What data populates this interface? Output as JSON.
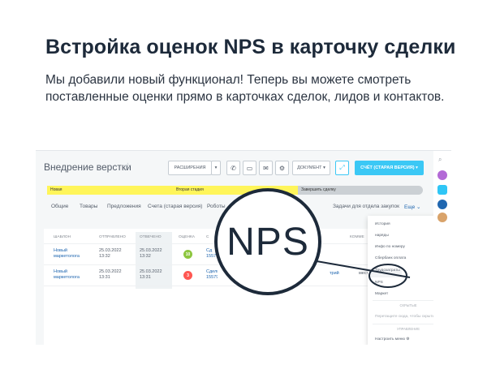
{
  "headline": "Встройка оценок NPS в карточку сделки",
  "subtext": "Мы добавили новый функционал! Теперь вы можете смотреть поставленные оценки прямо в карточках сделок, лидов и контактов.",
  "deal": {
    "title": "Внедрение верстки",
    "star_icon": "star-icon",
    "buttons": {
      "extensions": "РАСШИРЕНИЯ",
      "document": "ДОКУМЕНТ",
      "primary": "СЧЁТ (СТАРАЯ ВЕРСИЯ)"
    },
    "icons": [
      "phone-icon",
      "chat-icon",
      "mail-icon",
      "gear-icon"
    ],
    "stages": [
      "Новая",
      "Вторая стадия",
      "Завершить сделку"
    ]
  },
  "tabs": [
    "Общие",
    "Товары",
    "Предложения",
    "Счета (старая версия)",
    "Роботы",
    "Задачи для отдела закупок",
    "Еще"
  ],
  "table": {
    "headers": [
      "ШАБЛОН",
      "ОТПРАВЛЕНО",
      "ОТВЕЧЕНО",
      "ОЦЕНКА",
      "С",
      "КОММЕ"
    ],
    "rows": [
      {
        "template": "Новый маркетолога",
        "sent": "25.03.2022 13:32",
        "answered": "25.03.2022 13:32",
        "score": "10",
        "deal": "Сд 1557",
        "author": "",
        "comment": ""
      },
      {
        "template": "Новый маркетолога",
        "sent": "25.03.2022 13:31",
        "answered": "25.03.2022 13:31",
        "score": "3",
        "deal": "Сделк 15579",
        "author": "трий",
        "comment": "мест"
      }
    ]
  },
  "menu": {
    "items": [
      "История",
      "наряды",
      "Инфо по номеру",
      "Сбербанк оплата",
      "Трудозатраты",
      "NPS",
      "Маркет"
    ],
    "hidden_section": "СКРЫТЫЕ",
    "hidden_hint": "Перетащите сюда, чтобы скрыть",
    "manage_section": "УПРАВЛЕНИЕ",
    "configure": "Настроить меню"
  },
  "magnifier_text": "NPS",
  "colors": {
    "primary": "#3bc8f5",
    "stage_active": "#fff55a",
    "link": "#2067b0",
    "score_high": "#8dc63f",
    "score_low": "#ff5752"
  }
}
